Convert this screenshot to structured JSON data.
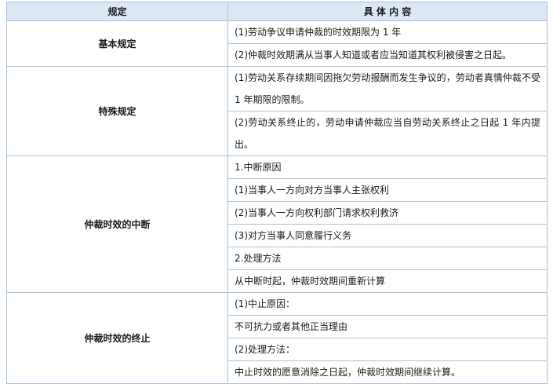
{
  "header": {
    "col1": "规定",
    "col2": "具 体 内 容"
  },
  "sections": [
    {
      "label": "基本规定",
      "rows": [
        "(1)劳动争议申请仲裁的时效期限为 1 年",
        "(2)仲裁时效期满从当事人知道或者应当知道其权利被侵害之日起。"
      ]
    },
    {
      "label": "特殊规定",
      "rows": [
        "(1)劳动关系存续期间因拖欠劳动报酬而发生争议的，劳动者真情仲裁不受 1 年期限的限制。",
        "(2)劳动关系终止的，劳动申请仲裁应当自劳动关系终止之日起 1 年内提出。"
      ]
    },
    {
      "label": "仲裁时效的中断",
      "rows": [
        "1.中断原因",
        "(1)当事人一方向对方当事人主张权利",
        "(2)当事人一方向权利部门请求权利救济",
        "(3)对方当事人同意履行义务",
        "2.处理方法",
        "从中断时起，仲裁时效期间重新计算"
      ]
    },
    {
      "label": "仲裁时效的终止",
      "rows": [
        "(1)中止原因：",
        "不可抗力或者其他正当理由",
        "(2)处理方法：",
        "中止时效的愿意消除之日起，仲裁时效期间继续计算。"
      ]
    }
  ]
}
